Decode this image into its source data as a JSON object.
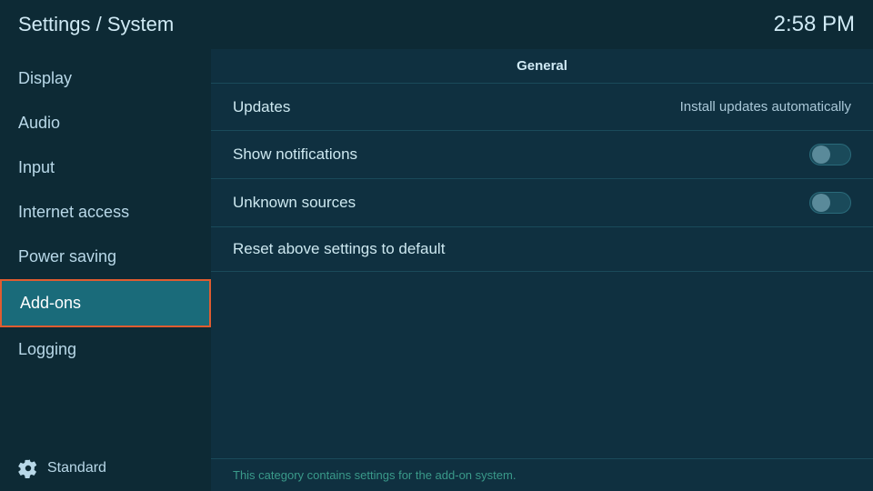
{
  "header": {
    "title": "Settings / System",
    "time": "2:58 PM"
  },
  "sidebar": {
    "items": [
      {
        "id": "display",
        "label": "Display",
        "active": false
      },
      {
        "id": "audio",
        "label": "Audio",
        "active": false
      },
      {
        "id": "input",
        "label": "Input",
        "active": false
      },
      {
        "id": "internet-access",
        "label": "Internet access",
        "active": false
      },
      {
        "id": "power-saving",
        "label": "Power saving",
        "active": false
      },
      {
        "id": "add-ons",
        "label": "Add-ons",
        "active": true
      },
      {
        "id": "logging",
        "label": "Logging",
        "active": false
      }
    ],
    "bottom_label": "Standard"
  },
  "content": {
    "section_header": "General",
    "settings": [
      {
        "id": "updates",
        "label": "Updates",
        "type": "text",
        "value": "Install updates automatically"
      },
      {
        "id": "show-notifications",
        "label": "Show notifications",
        "type": "toggle",
        "enabled": false
      },
      {
        "id": "unknown-sources",
        "label": "Unknown sources",
        "type": "toggle",
        "enabled": false
      },
      {
        "id": "reset-settings",
        "label": "Reset above settings to default",
        "type": "action"
      }
    ],
    "status_text": "This category contains settings for the add-on system."
  }
}
